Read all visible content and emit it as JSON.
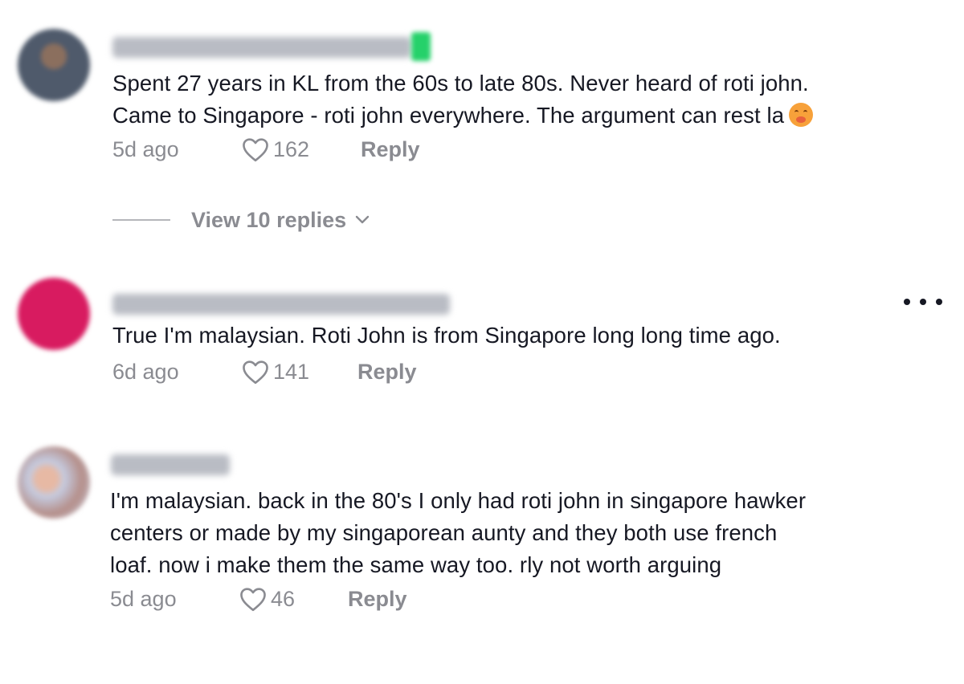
{
  "comments": [
    {
      "username": "MoneyChanger@Official",
      "text_lines": [
        "Spent 27 years in KL from the 60s to late 80s. Never heard of roti john.",
        "Came to Singapore - roti john everywhere. The argument can rest la"
      ],
      "time": "5d ago",
      "likes": "162",
      "reply_label": "Reply",
      "avatar_color": "#7d7a78"
    },
    {
      "username": "Jim_heeenerson@yahoo.com",
      "text_lines": [
        "True I'm malaysian. Roti John is from Singapore long long time ago."
      ],
      "time": "6d ago",
      "likes": "141",
      "reply_label": "Reply",
      "avatar_color": "#d81b60"
    },
    {
      "username": "Vincent sg",
      "text_lines": [
        "I'm malaysian. back in the 80's I only had roti john in singapore hawker",
        "centers or made by my singaporean aunty and they both use french",
        "loaf. now i make them the same way too. rly not worth arguing"
      ],
      "time": "5d ago",
      "likes": "46",
      "reply_label": "Reply",
      "avatar_color": "#c9b7ae"
    }
  ],
  "view_replies": {
    "label": "View 10 replies"
  },
  "colors": {
    "text": "#161823",
    "meta": "#8a8b91",
    "badge": "#25d16a"
  },
  "icons": {
    "like": "heart-outline-icon",
    "chevron": "chevron-down-icon",
    "more": "more-options-icon",
    "emoji": "blushing-face-emoji"
  }
}
